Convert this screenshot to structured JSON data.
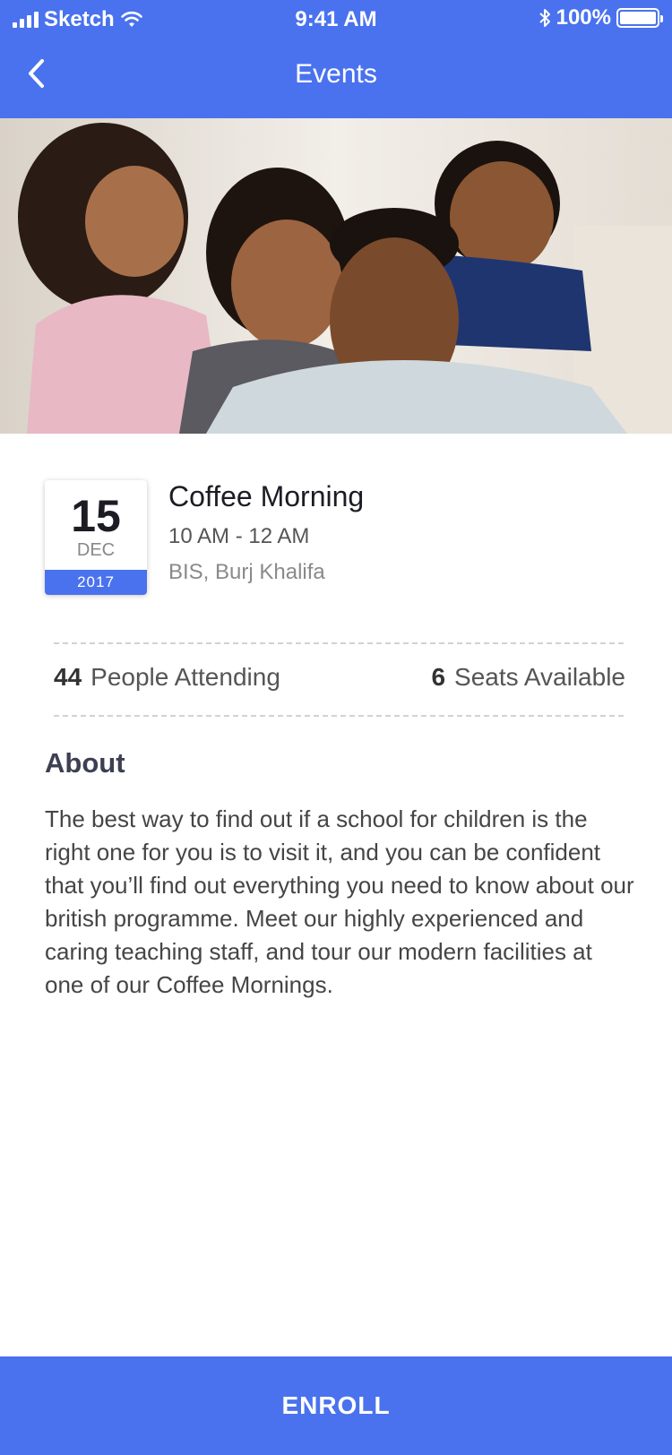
{
  "status_bar": {
    "carrier": "Sketch",
    "time": "9:41 AM",
    "battery": "100%"
  },
  "nav": {
    "title": "Events"
  },
  "event": {
    "day": "15",
    "month": "DEC",
    "year": "2017",
    "title": "Coffee Morning",
    "time": "10 AM - 12 AM",
    "location": "BIS, Burj Khalifa"
  },
  "stats": {
    "attending_count": "44",
    "attending_label": "People Attending",
    "seats_count": "6",
    "seats_label": "Seats Available"
  },
  "about": {
    "heading": "About",
    "body": "The best way to find out if a school for children is the right one for you is to visit it, and you can be confident that you’ll find out everything you need to know about our british programme. Meet our highly experienced and caring teaching staff, and tour our modern facilities at one of our Coffee Mornings."
  },
  "actions": {
    "enroll_label": "ENROLL"
  },
  "colors": {
    "primary": "#4a72ee"
  }
}
